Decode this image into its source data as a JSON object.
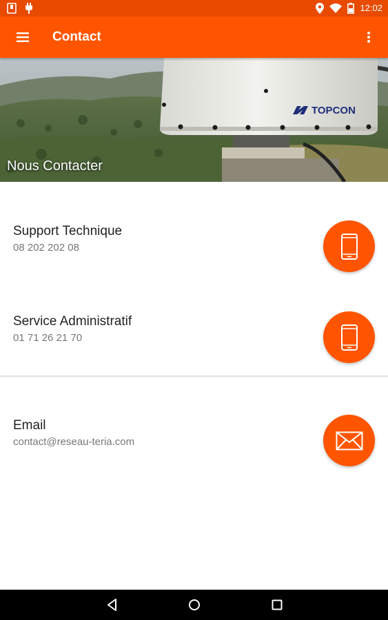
{
  "status_bar": {
    "time": "12:02"
  },
  "app_bar": {
    "title": "Contact"
  },
  "banner": {
    "title": "Nous Contacter",
    "dome_brand": "TOPCON"
  },
  "contacts": [
    {
      "label": "Support Technique",
      "value": "08 202 202 08",
      "action_icon": "phone-icon"
    },
    {
      "label": "Service Administratif",
      "value": "01 71 26 21 70",
      "action_icon": "phone-icon"
    },
    {
      "label": "Email",
      "value": "contact@reseau-teria.com",
      "action_icon": "mail-icon"
    }
  ],
  "colors": {
    "primary": "#ff5500",
    "status_bar": "#e84a00",
    "nav_bar": "#000000"
  }
}
